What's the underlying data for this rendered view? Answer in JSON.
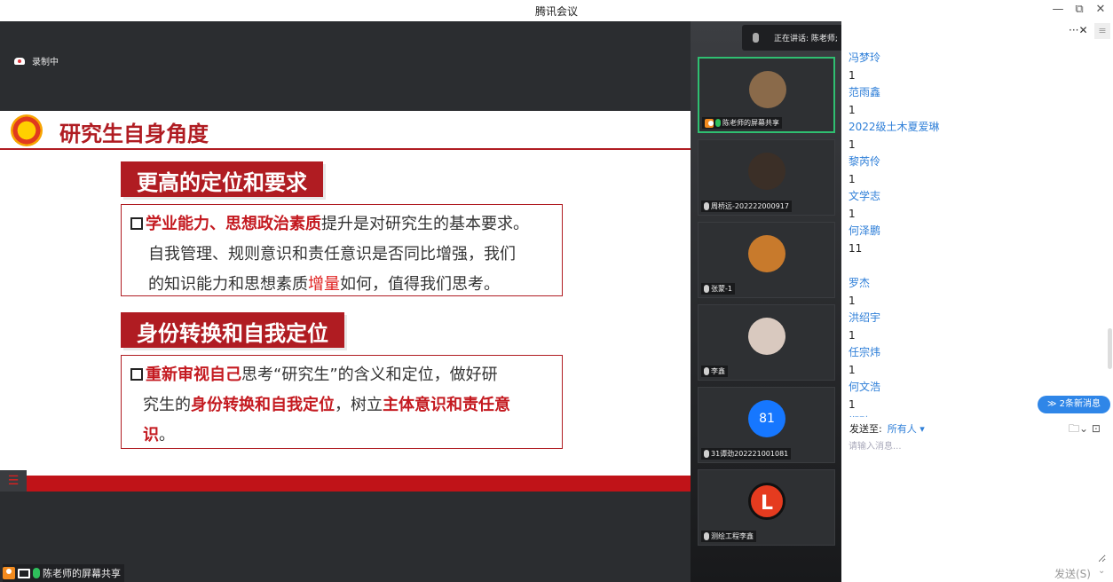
{
  "window": {
    "title": "腾讯会议",
    "minimize": "—",
    "restore": "⧉",
    "close": "✕"
  },
  "recording": {
    "label": "录制中"
  },
  "slide": {
    "title": "研究生自身角度",
    "section1": "更高的定位和要求",
    "box1": {
      "highlight": "学业能力、思想政治素质",
      "text1": "提升是对研究生的基本要求。",
      "line2": "自我管理、规则意识和责任意识是否同比增强，我们",
      "line3a": "的知识能力和思想素质",
      "line3b": "增量",
      "line3c": "如何，值得我们思考。"
    },
    "section2": "身份转换和自我定位",
    "box2": {
      "highlight": "重新审视自己",
      "text1": "思考“研究生”的含义和定位，做好研",
      "line2a": "究生的",
      "line2b": "身份转换和自我定位",
      "line2c": "，树立",
      "line2d": "主体意识和责任意",
      "line3a": "识",
      "line3b": "。"
    }
  },
  "share_label": "陈老师的屏幕共享",
  "menu_glyph": "☰",
  "speaking": {
    "label": "正在讲话: 陈老师;"
  },
  "participants": [
    {
      "name": "陈老师的屏幕共享",
      "avatar_color": "#8a6a4a",
      "avatar_text": ""
    },
    {
      "name": "周桥远-202222000917",
      "avatar_color": "#3b2f27",
      "avatar_text": ""
    },
    {
      "name": "张蒙-1",
      "avatar_color": "#c87a2c",
      "avatar_text": ""
    },
    {
      "name": "李鑫",
      "avatar_color": "#d9c9bf",
      "avatar_text": ""
    },
    {
      "name": "31谭劲202221001081",
      "avatar_color": "#1677ff",
      "avatar_text": "81"
    },
    {
      "name": "测绘工程李鑫",
      "avatar_color": "#e53b1f",
      "avatar_text": "L"
    }
  ],
  "chat": {
    "more": "···✕",
    "menu": "≡",
    "messages": [
      {
        "sender": "冯梦玲",
        "text": "1"
      },
      {
        "sender": "范雨鑫",
        "text": "1"
      },
      {
        "sender": "2022级土木夏爱琳",
        "text": "1"
      },
      {
        "sender": "黎芮伶",
        "text": "1"
      },
      {
        "sender": "文学志",
        "text": "1"
      },
      {
        "sender": "何泽鹏",
        "text": "11"
      },
      {
        "sender": "罗杰",
        "text": "1"
      },
      {
        "sender": "洪绍宇",
        "text": "1"
      },
      {
        "sender": "任宗炜",
        "text": "1"
      },
      {
        "sender": "何文浩",
        "text": "1"
      },
      {
        "sender": "郑劲",
        "text": ""
      }
    ],
    "new_messages": "≫ 2条新消息",
    "send_to_label": "发送至:",
    "send_to_value": "所有人 ▾",
    "tools": "🗀⌄ ⊡",
    "placeholder": "请输入消息...",
    "send_button": "发送(S)",
    "send_arrow": "⌄"
  }
}
